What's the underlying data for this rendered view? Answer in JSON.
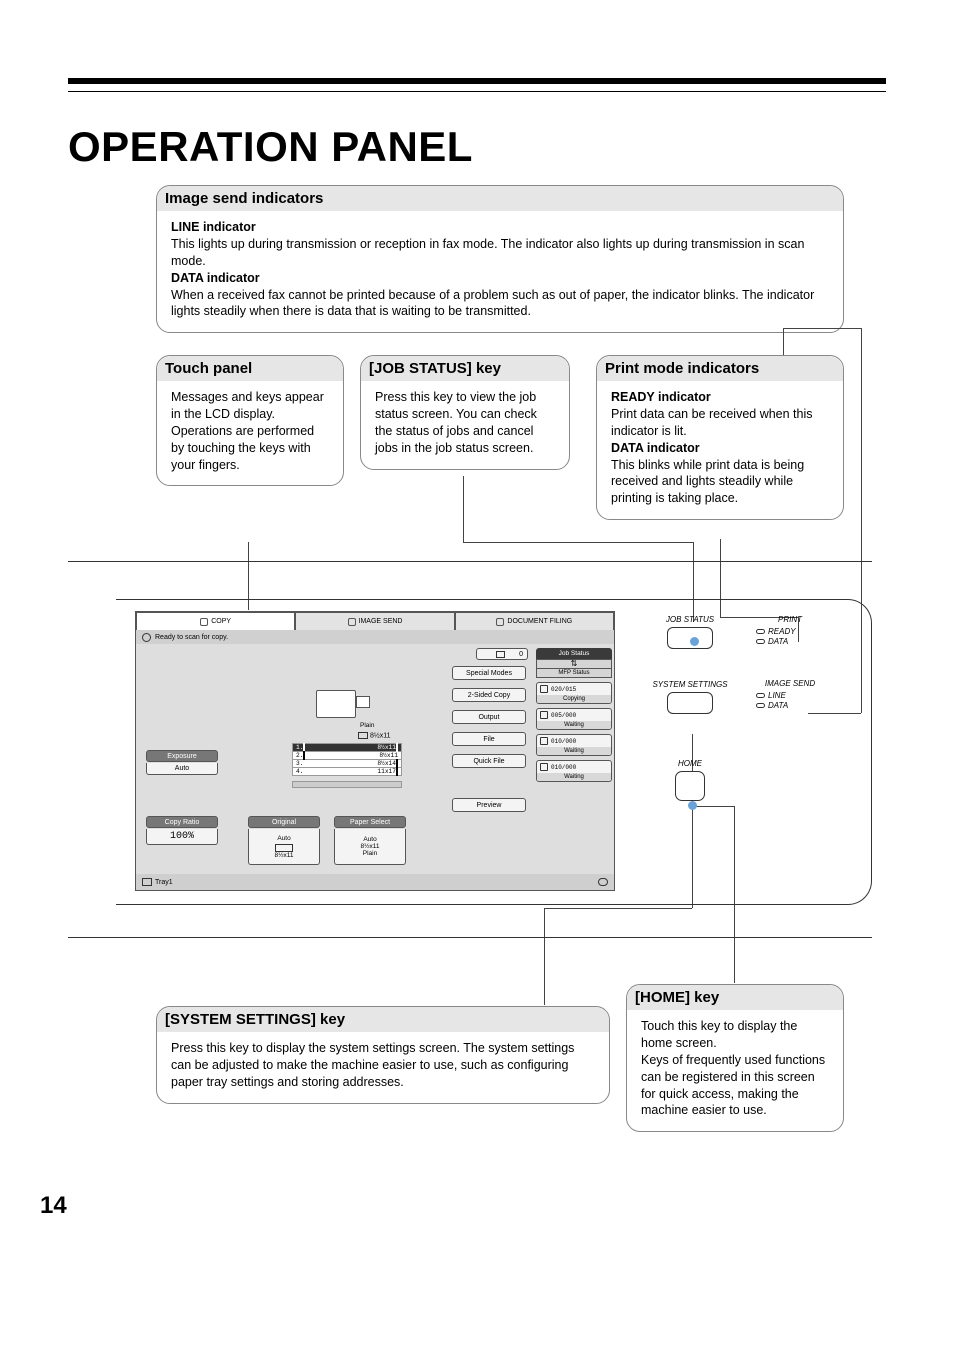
{
  "page_title": "OPERATION PANEL",
  "page_number": "14",
  "callouts": {
    "image_send": {
      "heading": "Image send indicators",
      "line_label": "LINE indicator",
      "line_text": "This lights up during transmission or reception in fax mode. The indicator also lights up during transmission in scan mode.",
      "data_label": "DATA indicator",
      "data_text1": "When a received fax cannot be printed because of a problem such as out of paper, the indicator blinks.",
      "data_text2": "The indicator lights steadily when there is data that is waiting to be transmitted."
    },
    "touch_panel": {
      "heading": "Touch panel",
      "text1": "Messages and keys appear in the LCD display.",
      "text2": "Operations are performed by touching the keys with your fingers."
    },
    "job_status": {
      "heading": "[JOB STATUS] key",
      "text": "Press this key to view the job status screen. You can check the status of jobs and cancel jobs in the job status screen."
    },
    "print_mode": {
      "heading": "Print mode indicators",
      "ready_label": "READY indicator",
      "ready_text": "Print data can be received when this indicator is lit.",
      "data_label": "DATA indicator",
      "data_text": "This blinks while print data is being received and lights steadily while printing is taking place."
    },
    "system_settings": {
      "heading": "[SYSTEM SETTINGS] key",
      "text": "Press this key to display the system settings screen. The system settings can be adjusted to make the machine easier to use, such as configuring paper tray settings and storing addresses."
    },
    "home": {
      "heading": "[HOME] key",
      "text1": "Touch this key to display the home screen.",
      "text2": "Keys of frequently used functions can be registered in this screen for quick access, making the machine easier to use."
    }
  },
  "lcd": {
    "tabs": {
      "copy": "COPY",
      "image_send": "IMAGE SEND",
      "doc_filing": "DOCUMENT FILING"
    },
    "status_msg": "Ready to scan for copy.",
    "counter_top": "0",
    "plain": "Plain",
    "paper_size": "8½x11",
    "trays": {
      "t1": "1.",
      "t1s": "8½x11",
      "t2": "2.",
      "t2s": "8½x11",
      "t3": "3.",
      "t3s": "8½x14",
      "t4": "4.",
      "t4s": "11x17"
    },
    "buttons": {
      "exposure": "Exposure",
      "auto": "Auto",
      "copy_ratio": "Copy Ratio",
      "pct": "100%",
      "original": "Original",
      "orig_auto": "Auto",
      "orig_size": "8½x11",
      "paper_select": "Paper Select",
      "ps_auto": "Auto",
      "ps_size": "8½x11",
      "ps_type": "Plain",
      "special_modes": "Special Modes",
      "two_sided": "2-Sided Copy",
      "output": "Output",
      "file": "File",
      "quick_file": "Quick File",
      "preview": "Preview"
    },
    "tray_bottom": "Tray1",
    "joblist": {
      "head": "Job Status",
      "mfp": "MFP Status",
      "r1_count": "020/015",
      "r1_label": "Copying",
      "r2_count": "005/000",
      "r2_label": "Waiting",
      "r3_count": "010/000",
      "r3_label": "Waiting",
      "r4_count": "010/000",
      "r4_label": "Waiting"
    }
  },
  "physical": {
    "job_status": "JOB STATUS",
    "print": "PRINT",
    "ready": "READY",
    "data": "DATA",
    "system_settings": "SYSTEM SETTINGS",
    "image_send": "IMAGE SEND",
    "line": "LINE",
    "home": "HOME"
  }
}
